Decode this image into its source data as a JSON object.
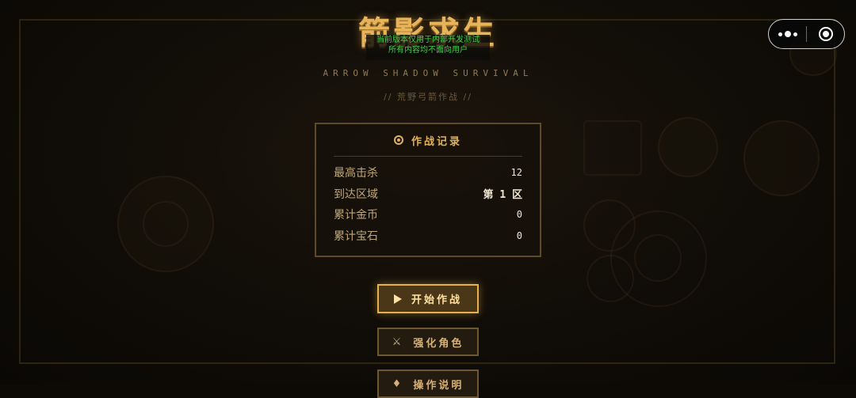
{
  "game": {
    "title": "箭影求生",
    "subtitle_en": "ARROW SHADOW SURVIVAL",
    "subtitle_cn": "// 荒野弓箭作战 //"
  },
  "dev_notice": {
    "line1": "当前版本仅用于内部开发测试",
    "line2": "所有内容均不面向用户"
  },
  "record": {
    "title": "作战记录",
    "rows": [
      {
        "label": "最高击杀",
        "value": "12"
      },
      {
        "label": "到达区域",
        "value": "第 1 区"
      },
      {
        "label": "累计金币",
        "value": "0"
      },
      {
        "label": "累计宝石",
        "value": "0"
      }
    ]
  },
  "buttons": {
    "start": "开始作战",
    "upgrade": "强化角色",
    "guide": "操作说明"
  },
  "icons": {
    "record": "target-icon",
    "start": "play-icon",
    "upgrade": "crossed-swords-icon",
    "guide": "book-icon",
    "more": "more-dots-icon",
    "close": "close-target-icon"
  },
  "colors": {
    "accent": "#e8b04a",
    "title": "#e8b45a",
    "notice": "#3ed24a",
    "background": "#0d0a06"
  }
}
